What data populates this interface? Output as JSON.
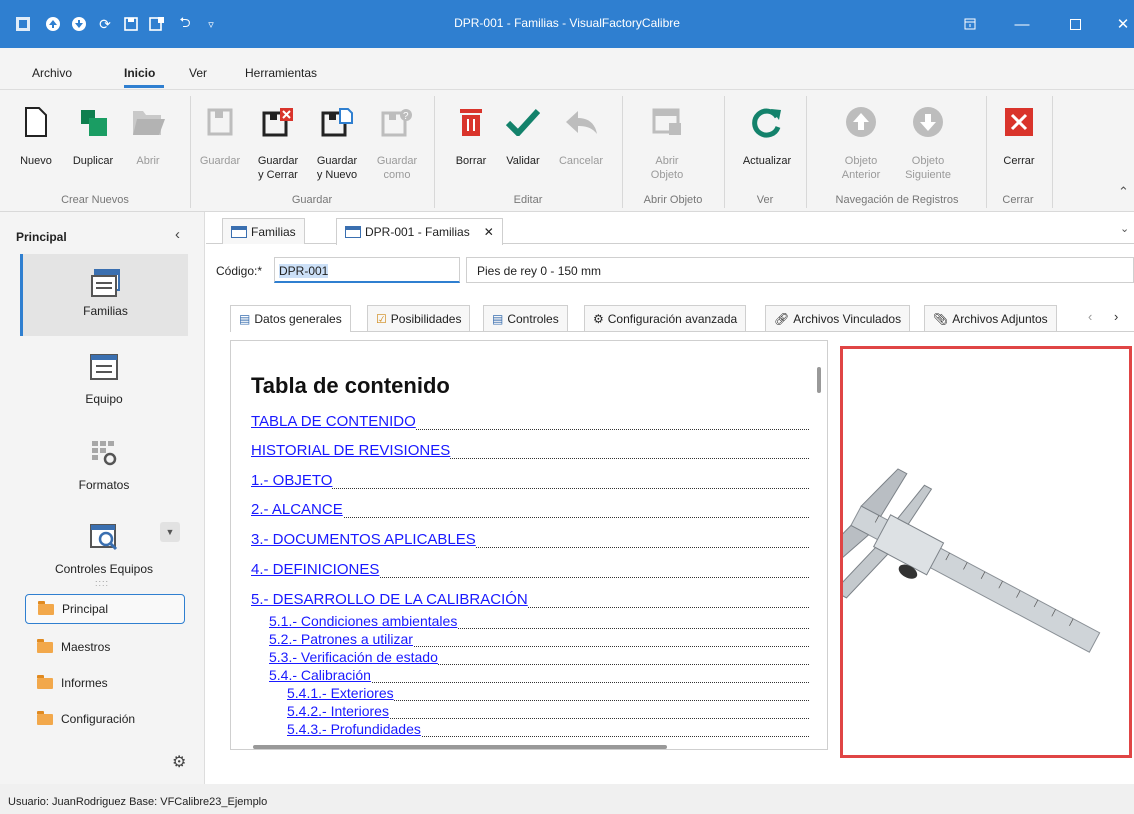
{
  "window": {
    "title": "DPR-001 - Familias - VisualFactoryCalibre"
  },
  "menu": {
    "items": [
      "Archivo",
      "Inicio",
      "Ver",
      "Herramientas"
    ]
  },
  "ribbon": {
    "nuevo": "Nuevo",
    "duplicar": "Duplicar",
    "abrir": "Abrir",
    "guardar": "Guardar",
    "guardar_cerrar_1": "Guardar",
    "guardar_cerrar_2": "y Cerrar",
    "guardar_nuevo_1": "Guardar",
    "guardar_nuevo_2": "y Nuevo",
    "guardar_como_1": "Guardar",
    "guardar_como_2": "como",
    "borrar": "Borrar",
    "validar": "Validar",
    "cancelar": "Cancelar",
    "abrir_objeto_1": "Abrir",
    "abrir_objeto_2": "Objeto",
    "actualizar": "Actualizar",
    "objeto_anterior_1": "Objeto",
    "objeto_anterior_2": "Anterior",
    "objeto_siguiente_1": "Objeto",
    "objeto_siguiente_2": "Siguiente",
    "cerrar": "Cerrar",
    "groups": {
      "crear_nuevos": "Crear Nuevos",
      "guardar": "Guardar",
      "editar": "Editar",
      "abrir_objeto": "Abrir Objeto",
      "ver": "Ver",
      "navegacion": "Navegación de Registros",
      "cerrar": "Cerrar"
    }
  },
  "left_pane": {
    "title": "Principal",
    "big_items": [
      "Familias",
      "Equipo",
      "Formatos",
      "Controles Equipos"
    ],
    "list_items": [
      "Principal",
      "Maestros",
      "Informes",
      "Configuración"
    ]
  },
  "doc_tabs": [
    "Familias",
    "DPR-001 - Familias"
  ],
  "form": {
    "codigo_label": "Código:*",
    "codigo_value": "DPR-001",
    "description_value": "Pies de rey 0 - 150 mm"
  },
  "inner_tabs": [
    "Datos generales",
    "Posibilidades",
    "Controles",
    "Configuración avanzada",
    "Archivos Vinculados",
    "Archivos Adjuntos"
  ],
  "document": {
    "heading": "Tabla de contenido",
    "entries": [
      "TABLA DE CONTENIDO",
      "HISTORIAL DE REVISIONES",
      "1.- OBJETO",
      "2.- ALCANCE",
      "3.- DOCUMENTOS APLICABLES",
      "4.- DEFINICIONES",
      "5.- DESARROLLO DE LA CALIBRACIÓN",
      "5.1.- Condiciones ambientales",
      "5.2.- Patrones a utilizar",
      "5.3.- Verificación de estado",
      "5.4.- Calibración",
      "5.4.1.- Exteriores",
      "5.4.2.- Interiores",
      "5.4.3.- Profundidades"
    ]
  },
  "status": {
    "text": "Usuario: JuanRodriguez   Base: VFCalibre23_Ejemplo"
  }
}
